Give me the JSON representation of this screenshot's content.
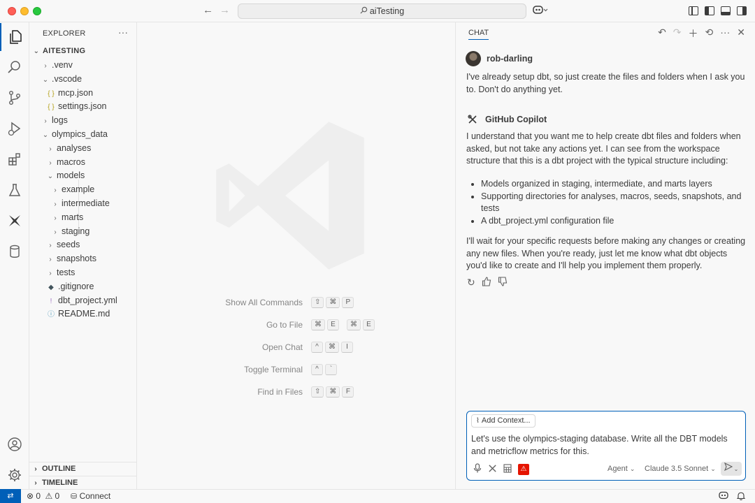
{
  "titlebar": {
    "title": "aiTesting",
    "back_icon": "←",
    "forward_icon": "→"
  },
  "activity": {
    "items": [
      "explorer-icon",
      "search-icon",
      "source-control-icon",
      "run-debug-icon",
      "extensions-icon",
      "testing-icon",
      "dbt-icon",
      "database-icon"
    ],
    "bottom": [
      "accounts-icon",
      "manage-gear-icon"
    ]
  },
  "explorer": {
    "header": "EXPLORER",
    "more": "···",
    "root": "AITESTING",
    "tree": [
      {
        "label": ".venv",
        "twisty": "›",
        "icon": "",
        "depth": 1
      },
      {
        "label": ".vscode",
        "twisty": "⌄",
        "icon": "",
        "depth": 1
      },
      {
        "label": "mcp.json",
        "twisty": "",
        "icon": "{ }",
        "depth": 2
      },
      {
        "label": "settings.json",
        "twisty": "",
        "icon": "{ }",
        "depth": 2
      },
      {
        "label": "logs",
        "twisty": "›",
        "icon": "",
        "depth": 1
      },
      {
        "label": "olympics_data",
        "twisty": "⌄",
        "icon": "",
        "depth": 1
      },
      {
        "label": "analyses",
        "twisty": "›",
        "icon": "",
        "depth": 2
      },
      {
        "label": "macros",
        "twisty": "›",
        "icon": "",
        "depth": 2
      },
      {
        "label": "models",
        "twisty": "⌄",
        "icon": "",
        "depth": 2
      },
      {
        "label": "example",
        "twisty": "›",
        "icon": "",
        "depth": 3
      },
      {
        "label": "intermediate",
        "twisty": "›",
        "icon": "",
        "depth": 3
      },
      {
        "label": "marts",
        "twisty": "›",
        "icon": "",
        "depth": 3
      },
      {
        "label": "staging",
        "twisty": "›",
        "icon": "",
        "depth": 3
      },
      {
        "label": "seeds",
        "twisty": "›",
        "icon": "",
        "depth": 2
      },
      {
        "label": "snapshots",
        "twisty": "›",
        "icon": "",
        "depth": 2
      },
      {
        "label": "tests",
        "twisty": "›",
        "icon": "",
        "depth": 2
      },
      {
        "label": ".gitignore",
        "twisty": "",
        "icon": "◆",
        "depth": 2
      },
      {
        "label": "dbt_project.yml",
        "twisty": "",
        "icon": "!",
        "depth": 2
      },
      {
        "label": "README.md",
        "twisty": "",
        "icon": "ⓘ",
        "depth": 2
      }
    ],
    "outline": "OUTLINE",
    "timeline": "TIMELINE"
  },
  "editor": {
    "shortcuts": [
      {
        "label": "Show All Commands",
        "keys": [
          "⇧",
          "⌘",
          "P"
        ]
      },
      {
        "label": "Go to File",
        "keys": [
          "⌘",
          "E",
          "|",
          "⌘",
          "E"
        ]
      },
      {
        "label": "Open Chat",
        "keys": [
          "^",
          "⌘",
          "I"
        ]
      },
      {
        "label": "Toggle Terminal",
        "keys": [
          "^",
          "`"
        ]
      },
      {
        "label": "Find in Files",
        "keys": [
          "⇧",
          "⌘",
          "F"
        ]
      }
    ]
  },
  "chat": {
    "tab": "CHAT",
    "user": {
      "name": "rob-darling",
      "message": "I've already setup dbt, so just create the files and folders when I ask you to. Don't do anything yet."
    },
    "assistant": {
      "name": "GitHub Copilot",
      "intro": "I understand that you want me to help create dbt files and folders when asked, but not take any actions yet. I can see from the workspace structure that this is a dbt project with the typical structure including:",
      "bullets": [
        "Models organized in staging, intermediate, and marts layers",
        "Supporting directories for analyses, macros, seeds, snapshots, and tests",
        "A dbt_project.yml configuration file"
      ],
      "outro": "I'll wait for your specific requests before making any changes or creating any new files. When you're ready, just let me know what dbt objects you'd like to create and I'll help you implement them properly."
    },
    "input": {
      "add_context": "Add Context...",
      "text": "Let's use the olympics-staging database. Write all the DBT models and metricflow metrics for this.",
      "mode": "Agent",
      "model": "Claude 3.5 Sonnet"
    }
  },
  "status": {
    "errors": "0",
    "warnings": "0",
    "connect": "Connect"
  }
}
